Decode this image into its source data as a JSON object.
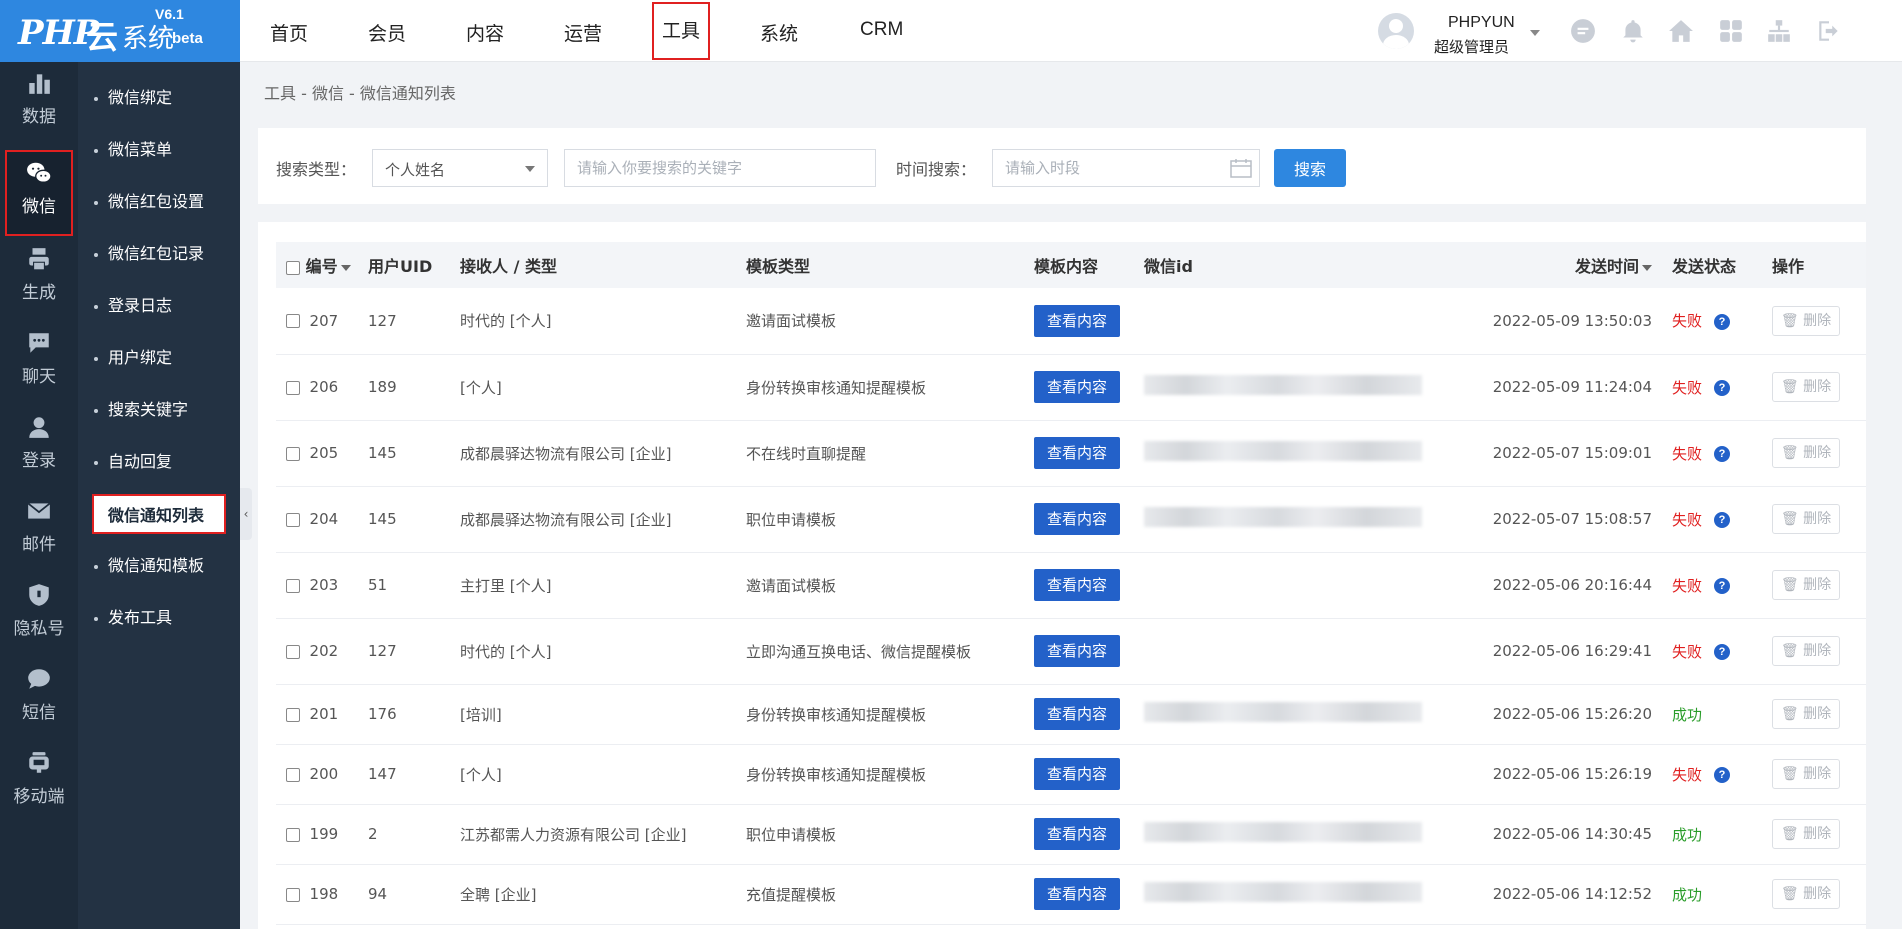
{
  "logo": {
    "brand": "PHP",
    "yun": "云",
    "system": "系统",
    "version": "V6.1",
    "beta": "beta"
  },
  "top_nav": [
    "首页",
    "会员",
    "内容",
    "运营",
    "工具",
    "系统",
    "CRM"
  ],
  "active_top_nav": "工具",
  "user": {
    "name": "PHPYUN",
    "role": "超级管理员"
  },
  "top_icons": [
    "chat-icon",
    "bell-icon",
    "home-icon",
    "grid-icon",
    "sitemap-icon",
    "logout-icon"
  ],
  "icon_sidebar": [
    {
      "label": "数据",
      "icon": "bar-chart-icon"
    },
    {
      "label": "微信",
      "icon": "wechat-icon"
    },
    {
      "label": "生成",
      "icon": "print-icon"
    },
    {
      "label": "聊天",
      "icon": "chat-bubble-icon"
    },
    {
      "label": "登录",
      "icon": "user-icon"
    },
    {
      "label": "邮件",
      "icon": "mail-icon"
    },
    {
      "label": "隐私号",
      "icon": "shield-icon"
    },
    {
      "label": "短信",
      "icon": "sms-icon"
    },
    {
      "label": "移动端",
      "icon": "mobile-icon"
    }
  ],
  "active_icon_sidebar": "微信",
  "submenu": [
    "微信绑定",
    "微信菜单",
    "微信红包设置",
    "微信红包记录",
    "登录日志",
    "用户绑定",
    "搜索关键字",
    "自动回复",
    "微信通知列表",
    "微信通知模板",
    "发布工具"
  ],
  "active_submenu": "微信通知列表",
  "breadcrumb": "工具 - 微信 - 微信通知列表",
  "search": {
    "type_label": "搜索类型：",
    "type_value": "个人姓名",
    "keyword_placeholder": "请输入你要搜索的关键字",
    "time_label": "时间搜索：",
    "time_placeholder": "请输入时段",
    "button": "搜索"
  },
  "table": {
    "headers": [
      "编号",
      "用户UID",
      "接收人 / 类型",
      "模板类型",
      "模板内容",
      "微信id",
      "发送时间",
      "发送状态",
      "操作"
    ],
    "view_label": "查看内容",
    "delete_label": "删除",
    "rows": [
      {
        "id": "207",
        "uid": "127",
        "receiver": "时代的 [个人]",
        "template": "邀请面试模板",
        "has_wxid": false,
        "time": "2022-05-09 13:50:03",
        "status": "失败"
      },
      {
        "id": "206",
        "uid": "189",
        "receiver": "[个人]",
        "template": "身份转换审核通知提醒模板",
        "has_wxid": true,
        "time": "2022-05-09 11:24:04",
        "status": "失败"
      },
      {
        "id": "205",
        "uid": "145",
        "receiver": "成都晨驿达物流有限公司 [企业]",
        "template": "不在线时直聊提醒",
        "has_wxid": true,
        "time": "2022-05-07 15:09:01",
        "status": "失败"
      },
      {
        "id": "204",
        "uid": "145",
        "receiver": "成都晨驿达物流有限公司 [企业]",
        "template": "职位申请模板",
        "has_wxid": true,
        "time": "2022-05-07 15:08:57",
        "status": "失败"
      },
      {
        "id": "203",
        "uid": "51",
        "receiver": "主打里 [个人]",
        "template": "邀请面试模板",
        "has_wxid": false,
        "time": "2022-05-06 20:16:44",
        "status": "失败"
      },
      {
        "id": "202",
        "uid": "127",
        "receiver": "时代的 [个人]",
        "template": "立即沟通互换电话、微信提醒模板",
        "has_wxid": false,
        "time": "2022-05-06 16:29:41",
        "status": "失败"
      },
      {
        "id": "201",
        "uid": "176",
        "receiver": "[培训]",
        "template": "身份转换审核通知提醒模板",
        "has_wxid": true,
        "time": "2022-05-06 15:26:20",
        "status": "成功"
      },
      {
        "id": "200",
        "uid": "147",
        "receiver": "[个人]",
        "template": "身份转换审核通知提醒模板",
        "has_wxid": false,
        "time": "2022-05-06 15:26:19",
        "status": "失败"
      },
      {
        "id": "199",
        "uid": "2",
        "receiver": "江苏都需人力资源有限公司 [企业]",
        "template": "职位申请模板",
        "has_wxid": true,
        "time": "2022-05-06 14:30:45",
        "status": "成功"
      },
      {
        "id": "198",
        "uid": "94",
        "receiver": "全聘 [企业]",
        "template": "充值提醒模板",
        "has_wxid": true,
        "time": "2022-05-06 14:12:52",
        "status": "成功"
      }
    ]
  },
  "colors": {
    "accent": "#2e87e0",
    "view_button": "#2361c9",
    "fail": "#e02020",
    "success": "#2a9d2a",
    "sidebar": "#1d2b3a",
    "submenu": "#233243"
  }
}
